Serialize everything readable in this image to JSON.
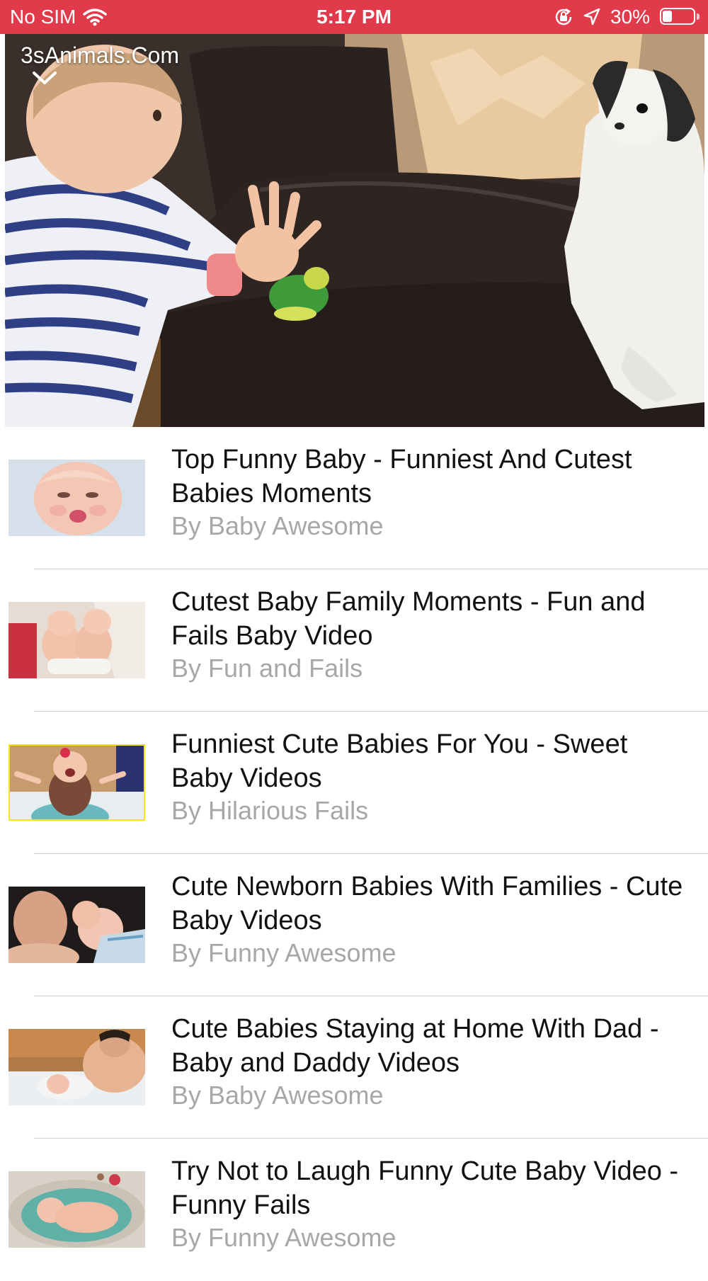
{
  "status_bar": {
    "carrier": "No SIM",
    "time": "5:17 PM",
    "battery": "30%",
    "battery_level": 0.3,
    "icons": [
      "wifi-icon",
      "rotation-lock-icon",
      "location-arrow-icon",
      "battery-icon"
    ],
    "background_color": "#e03a4b"
  },
  "player": {
    "watermark": "3sAnimals.Com",
    "collapse_icon": "chevron-down-icon"
  },
  "videos": [
    {
      "title": "Top Funny Baby - Funniest And Cutest Babies Moments",
      "author": "By Baby Awesome"
    },
    {
      "title": "Cutest Baby Family Moments - Fun and Fails Baby Video",
      "author": "By Fun and Fails"
    },
    {
      "title": "Funniest Cute Babies For You - Sweet Baby Videos",
      "author": "By Hilarious Fails"
    },
    {
      "title": "Cute Newborn Babies With Families - Cute Baby Videos",
      "author": "By Funny Awesome"
    },
    {
      "title": "Cute Babies Staying at Home With Dad - Baby and Daddy Videos",
      "author": "By Baby Awesome"
    },
    {
      "title": "Try Not to Laugh Funny Cute Baby Video -  Funny  Fails",
      "author": "By Funny Awesome"
    }
  ]
}
